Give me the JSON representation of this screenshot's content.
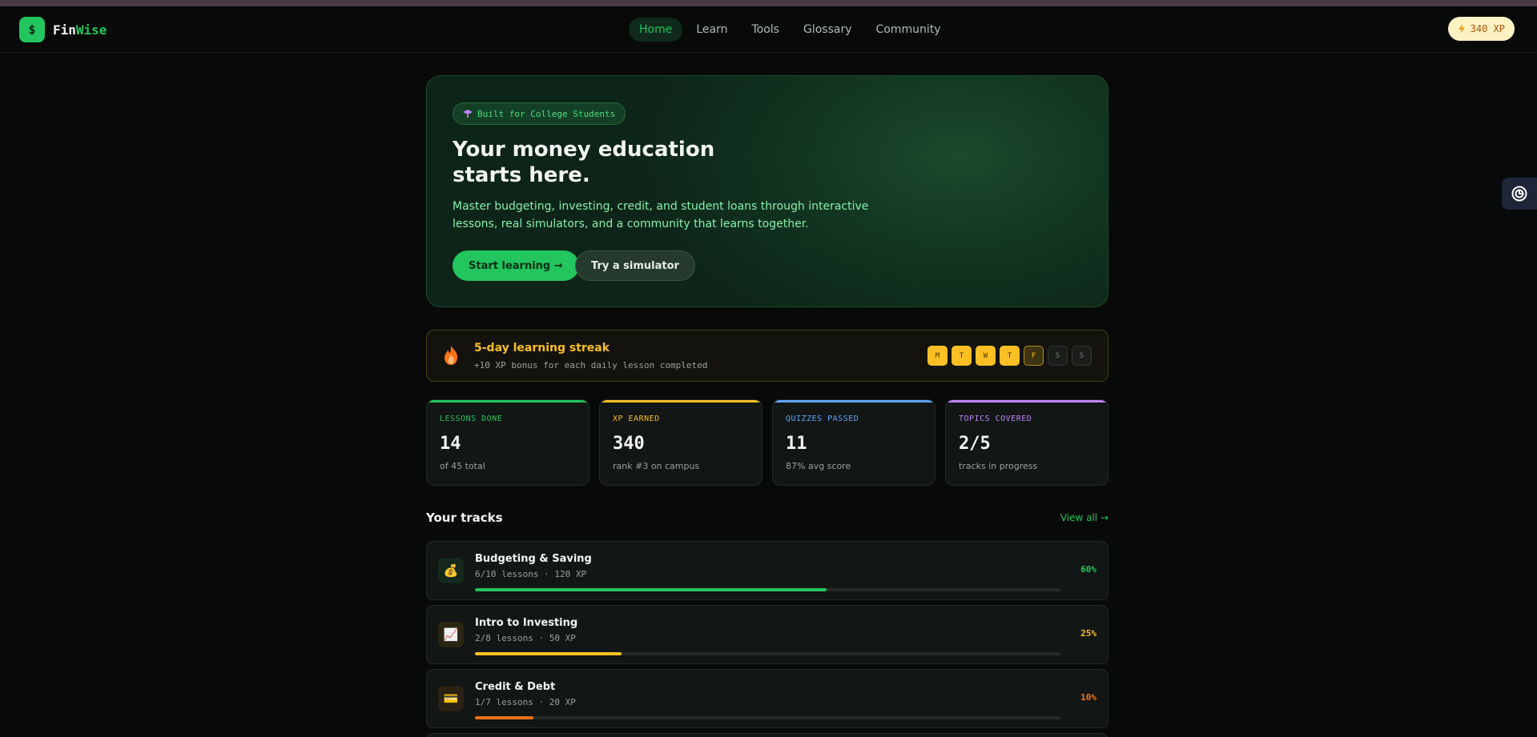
{
  "brand": {
    "logo_glyph": "$",
    "name_part1": "Fin",
    "name_part2": "Wise",
    "accent": "#22c55e"
  },
  "nav": {
    "links": [
      {
        "label": "Home",
        "active": true
      },
      {
        "label": "Learn"
      },
      {
        "label": "Tools"
      },
      {
        "label": "Glossary"
      },
      {
        "label": "Community"
      }
    ],
    "xp_badge": "340 XP"
  },
  "hero": {
    "badge": "Built for College Students",
    "title_line1": "Your money education",
    "title_line2": "starts here.",
    "subtitle": "Master budgeting, investing, credit, and student loans through interactive lessons, real simulators, and a community that learns together.",
    "primary_button": "Start learning →",
    "secondary_button": "Try a simulator"
  },
  "streak": {
    "title": "5-day learning streak",
    "subtitle": "+10 XP bonus for each daily lesson completed",
    "days": [
      {
        "label": "M",
        "state": "done"
      },
      {
        "label": "T",
        "state": "done"
      },
      {
        "label": "W",
        "state": "done"
      },
      {
        "label": "T",
        "state": "done"
      },
      {
        "label": "F",
        "state": "today"
      },
      {
        "label": "S",
        "state": "todo"
      },
      {
        "label": "S",
        "state": "todo"
      }
    ]
  },
  "stats": [
    {
      "label": "LESSONS DONE",
      "value": "14",
      "note": "of 45 total",
      "color": "#22c55e"
    },
    {
      "label": "XP EARNED",
      "value": "340",
      "note": "rank #3 on campus",
      "color": "#fbbf24"
    },
    {
      "label": "QUIZZES PASSED",
      "value": "11",
      "note": "87% avg score",
      "color": "#60a5fa"
    },
    {
      "label": "TOPICS COVERED",
      "value": "2/5",
      "note": "tracks in progress",
      "color": "#c084fc"
    }
  ],
  "tracks": {
    "title": "Your tracks",
    "view_all": "View all →",
    "items": [
      {
        "icon": "money-bag-icon",
        "glyph": "💰",
        "name": "Budgeting & Saving",
        "meta": "6/10 lessons · 120 XP",
        "percent_label": "60%",
        "progress": 0.6,
        "color": "#22c55e",
        "icon_bg": "#15291c"
      },
      {
        "icon": "chart-up-icon",
        "glyph": "📈",
        "name": "Intro to Investing",
        "meta": "2/8 lessons · 50 XP",
        "percent_label": "25%",
        "progress": 0.25,
        "color": "#fbbf24",
        "icon_bg": "#2a2614"
      },
      {
        "icon": "credit-card-icon",
        "glyph": "💳",
        "name": "Credit & Debt",
        "meta": "1/7 lessons · 20 XP",
        "percent_label": "10%",
        "progress": 0.1,
        "color": "#f97316",
        "icon_bg": "#2a2214"
      }
    ]
  }
}
